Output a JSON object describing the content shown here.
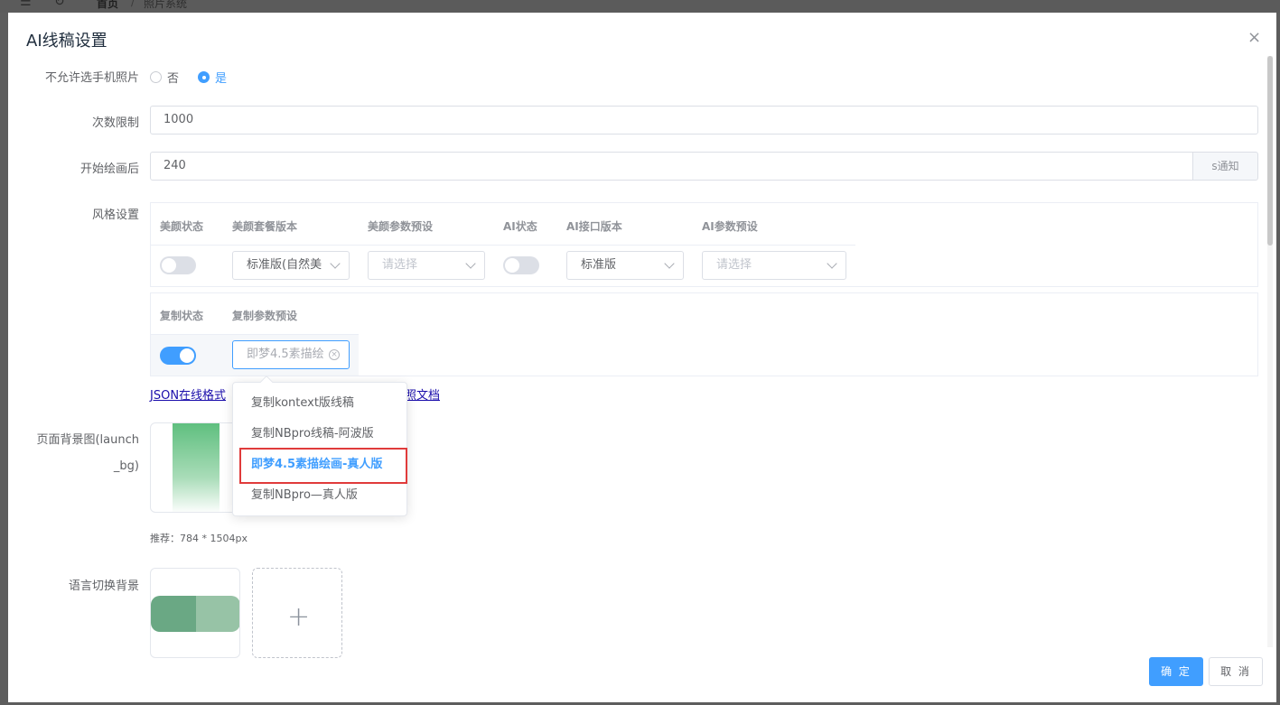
{
  "breadcrumb": {
    "home": "首页",
    "separator": "/",
    "current": "照片系统"
  },
  "dialog": {
    "title": "AI线稿设置",
    "close_glyph": "×"
  },
  "form": {
    "forbid_phone_photo": {
      "label": "不允许选手机照片",
      "options": [
        "否",
        "是"
      ],
      "selected": "是"
    },
    "count_limit": {
      "label": "次数限制",
      "value": "1000"
    },
    "start_notify": {
      "label": "开始绘画后",
      "value": "240",
      "append": "s通知"
    },
    "style": {
      "label": "风格设置",
      "table1": {
        "headers": [
          "美颜状态",
          "美颜套餐版本",
          "美颜参数预设",
          "AI状态",
          "AI接口版本",
          "AI参数预设"
        ],
        "beauty_status": false,
        "beauty_package": "标准版(自然美",
        "beauty_params_placeholder": "请选择",
        "ai_status": false,
        "ai_version": "标准版",
        "ai_params_placeholder": "请选择"
      },
      "table2": {
        "headers": [
          "复制状态",
          "复制参数预设"
        ],
        "copy_status": true,
        "copy_params": "即梦4.5素描绘"
      },
      "links": {
        "json_format": "JSON在线格式",
        "doc": "照文档"
      },
      "dropdown_options": [
        "复制kontext版线稿",
        "复制NBpro线稿-阿波版",
        "即梦4.5素描绘画-真人版",
        "复制NBpro—真人版"
      ],
      "dropdown_selected_index": 2
    },
    "launch_bg": {
      "label_line1": "页面背景图(launch",
      "label_line2": "_bg)",
      "tip": "推荐：784 * 1504px"
    },
    "lang_bg": {
      "label": "语言切换背景",
      "add_glyph": "+"
    }
  },
  "footer": {
    "confirm": "确 定",
    "cancel": "取 消"
  },
  "colors": {
    "primary": "#409eff",
    "highlight": "#e03b3b",
    "thumb_green": "#5fbf7f"
  }
}
